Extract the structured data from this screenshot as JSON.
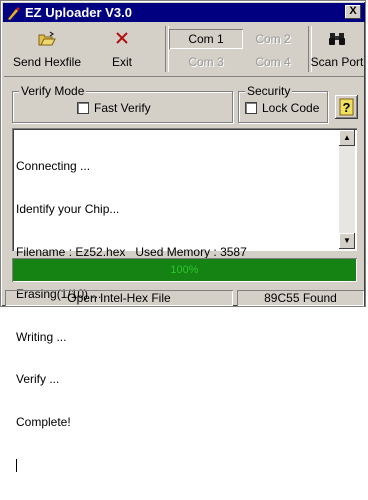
{
  "window": {
    "title": "EZ Uploader V3.0",
    "close_label": "X"
  },
  "toolbar": {
    "send_label": "Send Hexfile",
    "exit_label": "Exit",
    "scan_label": "Scan Port",
    "ports": [
      {
        "label": "Com 1",
        "state": "active"
      },
      {
        "label": "Com 2",
        "state": "disabled"
      },
      {
        "label": "Com 3",
        "state": "disabled"
      },
      {
        "label": "Com 4",
        "state": "disabled"
      }
    ]
  },
  "verify_mode": {
    "legend": "Verify Mode",
    "fast_verify_label": "Fast Verify",
    "fast_verify_checked": false
  },
  "security": {
    "legend": "Security",
    "lock_code_label": "Lock Code",
    "lock_code_checked": false
  },
  "help": {
    "label": "?"
  },
  "log": {
    "lines": [
      "Connecting ...",
      "Identify your Chip...",
      "Filename : Ez52.hex   Used Memory : 3587",
      "Erasing(1/10) ...",
      "Writing ...",
      "Verify ...",
      "Complete!"
    ]
  },
  "progress": {
    "value": 1.0,
    "label": "100%"
  },
  "statusbar": {
    "left": "Open Intel-Hex File",
    "right": "89C55 Found"
  },
  "colors": {
    "title_bar": "#000080",
    "progress": "#148314",
    "exit_icon": "#b01010"
  }
}
